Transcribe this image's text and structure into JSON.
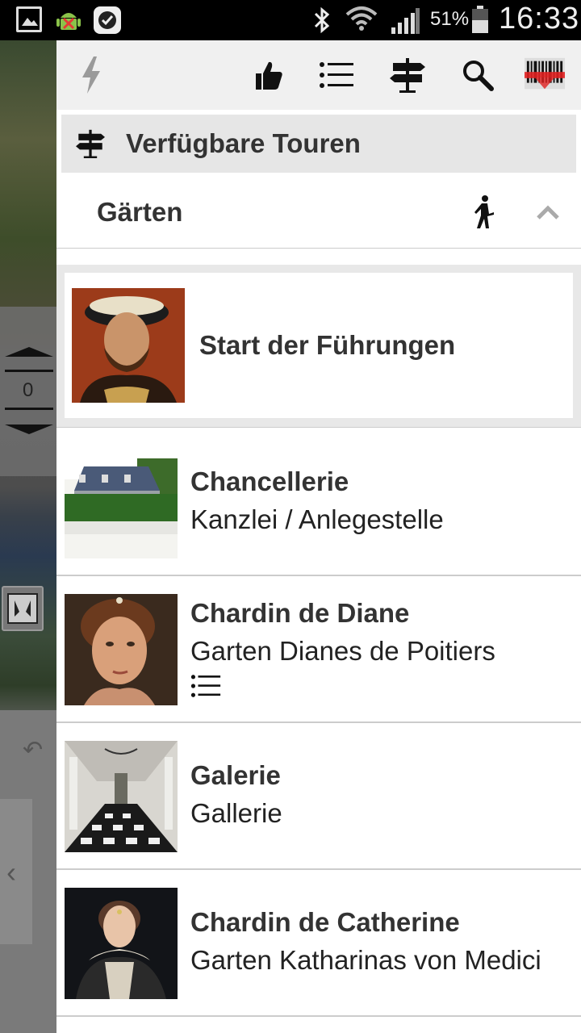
{
  "status_bar": {
    "battery_percent": "51%",
    "time": "16:33"
  },
  "map": {
    "level_value": "0"
  },
  "toolbar": {
    "icons": [
      "flash-icon",
      "thumbs-up-icon",
      "list-icon",
      "signpost-icon",
      "search-icon",
      "barcode-icon"
    ]
  },
  "section": {
    "title": "Verfügbare Touren"
  },
  "group": {
    "title": "Gärten"
  },
  "start": {
    "label": "Start der Führungen"
  },
  "items": [
    {
      "title": "Chancellerie",
      "subtitle": "Kanzlei / Anlegestelle",
      "has_list_icon": false
    },
    {
      "title": "Chardin de Diane",
      "subtitle": "Garten Dianes de Poitiers",
      "has_list_icon": true
    },
    {
      "title": "Galerie",
      "subtitle": "Gallerie",
      "has_list_icon": false
    },
    {
      "title": "Chardin de Catherine",
      "subtitle": "Garten Katharinas von Medici",
      "has_list_icon": false
    }
  ],
  "colors": {
    "toolbar_bg": "#f0f0f0",
    "header_bg": "#e6e6e6",
    "text_dark": "#333333",
    "barcode_red": "#e02020"
  }
}
